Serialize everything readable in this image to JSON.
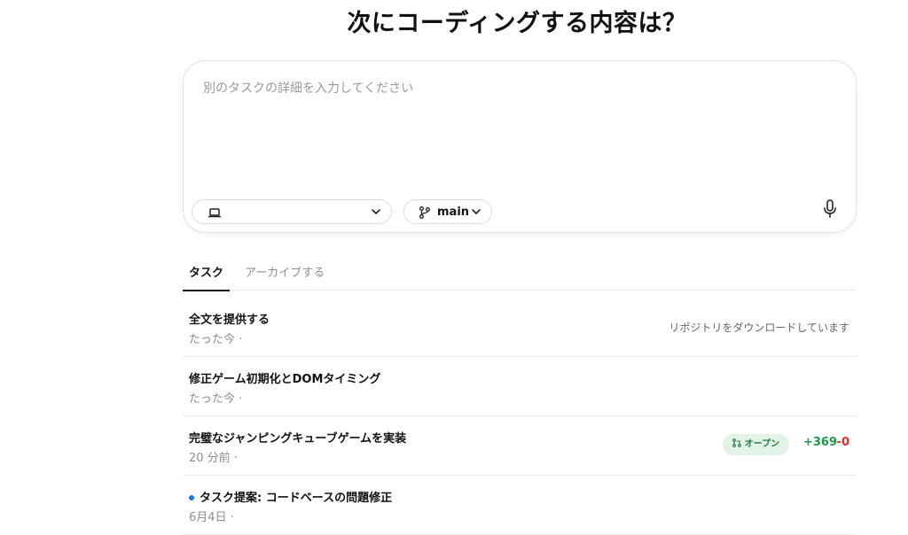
{
  "header": {
    "title": "次にコーディングする内容は？"
  },
  "composer": {
    "placeholder": "別のタスクの詳細を入力してください",
    "environment_value": "",
    "branch": "main"
  },
  "tabs": [
    {
      "label": "タスク",
      "active": true
    },
    {
      "label": "アーカイブする",
      "active": false
    }
  ],
  "tasks": [
    {
      "title": "全文を提供する",
      "meta": "たった今 ·",
      "status": "リポジトリをダウンロードしています"
    },
    {
      "title": "修正ゲーム初期化とDOMタイミング",
      "meta": "たった今 ·"
    },
    {
      "title": "完璧なジャンピングキューブゲームを実装",
      "meta": "20 分前 ·",
      "badge": "オープン",
      "additions": "+369",
      "deletions": "-0"
    },
    {
      "title": "タスク提案: コードベースの問題修正",
      "meta": "6月4日 ·",
      "unread": true
    }
  ],
  "colors": {
    "accent_green": "#1f9a4a",
    "accent_red": "#e0322d",
    "badge_bg": "#e2f2e6",
    "unread_dot": "#1a73e8"
  },
  "icons": [
    "laptop-icon",
    "chevron-down-icon",
    "git-branch-icon",
    "microphone-icon",
    "pull-request-icon"
  ]
}
